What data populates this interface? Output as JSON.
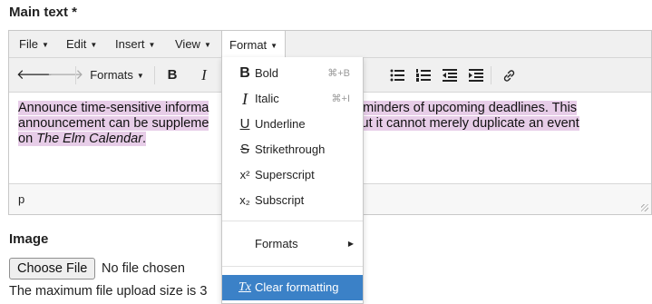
{
  "field_label": "Main text *",
  "menubar": [
    {
      "label": "File"
    },
    {
      "label": "Edit"
    },
    {
      "label": "Insert"
    },
    {
      "label": "View"
    },
    {
      "label": "Format"
    }
  ],
  "toolbar": {
    "formats_label": "Formats",
    "bold_label": "B",
    "italic_label": "I"
  },
  "content": {
    "text1": "Announce time-sensitive informa",
    "text2": "or reminders of upcoming deadlines. This",
    "text3": "announcement can be suppleme",
    "text4": "t, but it cannot merely duplicate an event",
    "text5": "on ",
    "text5_italic": "The Elm Calendar",
    "text5_end": "."
  },
  "status": {
    "path": "p"
  },
  "format_menu": {
    "bold": {
      "icon_text": "B",
      "label": "Bold",
      "shortcut": "⌘+B"
    },
    "italic": {
      "icon_text": "I",
      "label": "Italic",
      "shortcut": "⌘+I"
    },
    "underline": {
      "icon_text": "U",
      "label": "Underline"
    },
    "strike": {
      "icon_text": "S",
      "label": "Strikethrough"
    },
    "superscript": {
      "icon_text": "x²",
      "label": "Superscript"
    },
    "subscript": {
      "icon_text": "x₂",
      "label": "Subscript"
    },
    "formats": {
      "label": "Formats"
    },
    "clear": {
      "icon_text": "Tx",
      "label": "Clear formatting"
    }
  },
  "image_section": {
    "label": "Image",
    "choose_button": "Choose File",
    "no_file": "No file chosen",
    "upload_note": "The maximum file upload size is 3"
  },
  "colors": {
    "highlight": "#e7cde8",
    "menu_selected": "#3b81c7"
  }
}
